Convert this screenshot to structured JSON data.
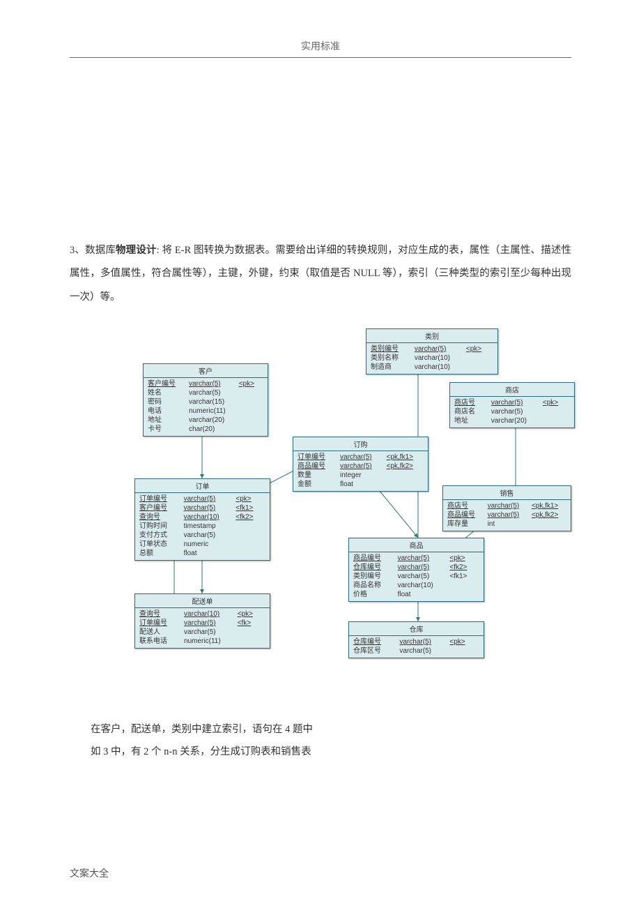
{
  "header": {
    "title": "实用标准"
  },
  "footer": {
    "text": "文案大全"
  },
  "section": {
    "heading_prefix": "3、数据库",
    "heading_bold": "物理设计",
    "heading_suffix": ": 将 E-R 图转换为数据表。需要给出详细的转换规则，对应生成的表，属性（主属性、描述性属性，多值属性，符合属性等），主键，外键，约束（取值是否 NULL 等），索引（三种类型的索引至少每种出现一次）等。"
  },
  "notes": {
    "line1": "在客户，配送单，类别中建立索引，语句在 4 题中",
    "line2": "如 3 中，有 2 个 n-n 关系，分生成订购表和销售表"
  },
  "entities": {
    "category": {
      "title": "类别",
      "rows": [
        {
          "name": "类别编号",
          "type": "varchar(5)",
          "key": "<pk>",
          "u": true
        },
        {
          "name": "类别名称",
          "type": "varchar(10)",
          "key": "",
          "u": false
        },
        {
          "name": "制造商",
          "type": "varchar(10)",
          "key": "",
          "u": false
        }
      ]
    },
    "customer": {
      "title": "客户",
      "rows": [
        {
          "name": "客户编号",
          "type": "varchar(5)",
          "key": "<pk>",
          "u": true
        },
        {
          "name": "姓名",
          "type": "varchar(5)",
          "key": "",
          "u": false
        },
        {
          "name": "密码",
          "type": "varchar(15)",
          "key": "",
          "u": false
        },
        {
          "name": "电话",
          "type": "numeric(11)",
          "key": "",
          "u": false
        },
        {
          "name": "地址",
          "type": "varchar(20)",
          "key": "",
          "u": false
        },
        {
          "name": "卡号",
          "type": "char(20)",
          "key": "",
          "u": false
        }
      ]
    },
    "shop": {
      "title": "商店",
      "rows": [
        {
          "name": "商店号",
          "type": "varchar(5)",
          "key": "<pk>",
          "u": true
        },
        {
          "name": "商店名",
          "type": "varchar(5)",
          "key": "",
          "u": false
        },
        {
          "name": "地址",
          "type": "varchar(20)",
          "key": "",
          "u": false
        }
      ]
    },
    "buy": {
      "title": "订购",
      "rows": [
        {
          "name": "订单编号",
          "type": "varchar(5)",
          "key": "<pk,fk1>",
          "u": true
        },
        {
          "name": "商品编号",
          "type": "varchar(5)",
          "key": "<pk,fk2>",
          "u": true
        },
        {
          "name": "数量",
          "type": "integer",
          "key": "",
          "u": false
        },
        {
          "name": "金额",
          "type": "float",
          "key": "",
          "u": false
        }
      ]
    },
    "order": {
      "title": "订单",
      "rows": [
        {
          "name": "订单编号",
          "type": "varchar(5)",
          "key": "<pk>",
          "u": true
        },
        {
          "name": "客户编号",
          "type": "varchar(5)",
          "key": "<fk1>",
          "u": true
        },
        {
          "name": "查询号",
          "type": "varchar(10)",
          "key": "<fk2>",
          "u": true
        },
        {
          "name": "订购时间",
          "type": "timestamp",
          "key": "",
          "u": false
        },
        {
          "name": "支付方式",
          "type": "varchar(5)",
          "key": "",
          "u": false
        },
        {
          "name": "订单状态",
          "type": "numeric",
          "key": "",
          "u": false
        },
        {
          "name": "总额",
          "type": "float",
          "key": "",
          "u": false
        }
      ]
    },
    "sale": {
      "title": "销售",
      "rows": [
        {
          "name": "商店号",
          "type": "varchar(5)",
          "key": "<pk,fk1>",
          "u": true
        },
        {
          "name": "商品编号",
          "type": "varchar(5)",
          "key": "<pk,fk2>",
          "u": true
        },
        {
          "name": "库存量",
          "type": "int",
          "key": "",
          "u": false
        }
      ]
    },
    "product": {
      "title": "商品",
      "rows": [
        {
          "name": "商品编号",
          "type": "varchar(5)",
          "key": "<pk>",
          "u": true
        },
        {
          "name": "仓库编号",
          "type": "varchar(5)",
          "key": "<fk2>",
          "u": true
        },
        {
          "name": "类别编号",
          "type": "varchar(5)",
          "key": "<fk1>",
          "u": false
        },
        {
          "name": "商品名称",
          "type": "varchar(10)",
          "key": "",
          "u": false
        },
        {
          "name": "价格",
          "type": "float",
          "key": "",
          "u": false
        }
      ]
    },
    "delivery": {
      "title": "配送单",
      "rows": [
        {
          "name": "查询号",
          "type": "varchar(10)",
          "key": "<pk>",
          "u": true
        },
        {
          "name": "订单编号",
          "type": "varchar(5)",
          "key": "<fk>",
          "u": true
        },
        {
          "name": "配送人",
          "type": "varchar(5)",
          "key": "",
          "u": false
        },
        {
          "name": "联系电话",
          "type": "numeric(11)",
          "key": "",
          "u": false
        }
      ]
    },
    "warehouse": {
      "title": "仓库",
      "rows": [
        {
          "name": "仓库编号",
          "type": "varchar(5)",
          "key": "<pk>",
          "u": true
        },
        {
          "name": "仓库区号",
          "type": "varchar(5)",
          "key": "",
          "u": false
        }
      ]
    }
  }
}
